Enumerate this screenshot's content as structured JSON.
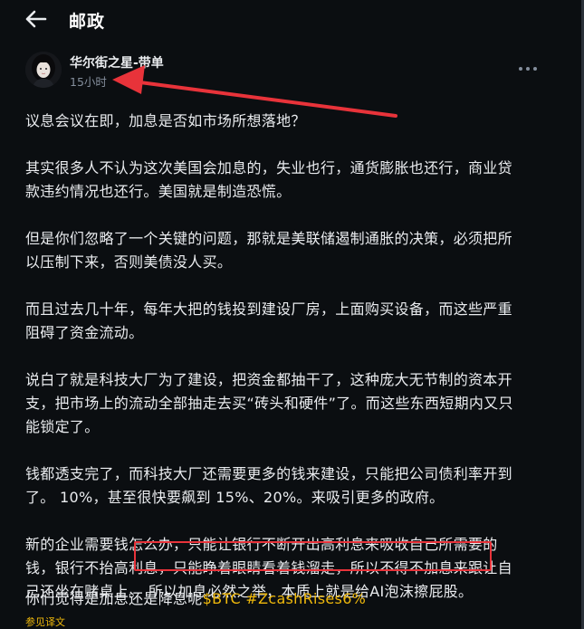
{
  "header": {
    "title": "邮政",
    "back_icon": "back-arrow-icon"
  },
  "author": {
    "name": "华尔街之星-带单",
    "time": "15小时"
  },
  "post": {
    "paragraphs": [
      "议息会议在即，加息是否如市场所想落地？",
      "其实很多人不认为这次美国会加息的，失业也行，通货膨胀也还行，商业贷\n款违约情况也还行。美国就是制造恐慌。",
      "但是你们忽略了一个关键的问题，那就是美联储遏制通胀的决策，必须把所\n以压制下来，否则美债没人买。",
      "而且过去几十年，每年大把的钱投到建设厂房，上面购买设备，而这些严重\n阻碍了资金流动。",
      "说白了就是科技大厂为了建设，把资金都抽干了，这种庞大无节制的资本开\n支，把市场上的流动全部抽走去买“砖头和硬件”了。而这些东西短期内又只\n能锁定了。",
      "钱都透支完了，而科技大厂还需要更多的钱来建设，只能把公司债利率开到\n了。 10%，甚至很快要飙到 15%、20%。来吸引更多的政府。",
      "新的企业需要钱怎么办，只能让银行不断开出高利息来吸收自己所需要的\n钱，银行不抬高利息，只能睁着眼睛看着钱溜走，所以不得不加息来跟让自\n己还坐在赌桌上。 所以加息必然之举，本质上就是给AI泡沫擦屁股。"
    ],
    "closing_text": "你们觉得是加息还是降息呢",
    "tags": [
      "$BTC",
      "#ZcashRises6%"
    ],
    "translate_label": "参见译文"
  },
  "colors": {
    "background": "#0b0e11",
    "text": "#eaecef",
    "muted": "#848e9c",
    "accent": "#f0b90b",
    "annotation": "#e8333a"
  }
}
